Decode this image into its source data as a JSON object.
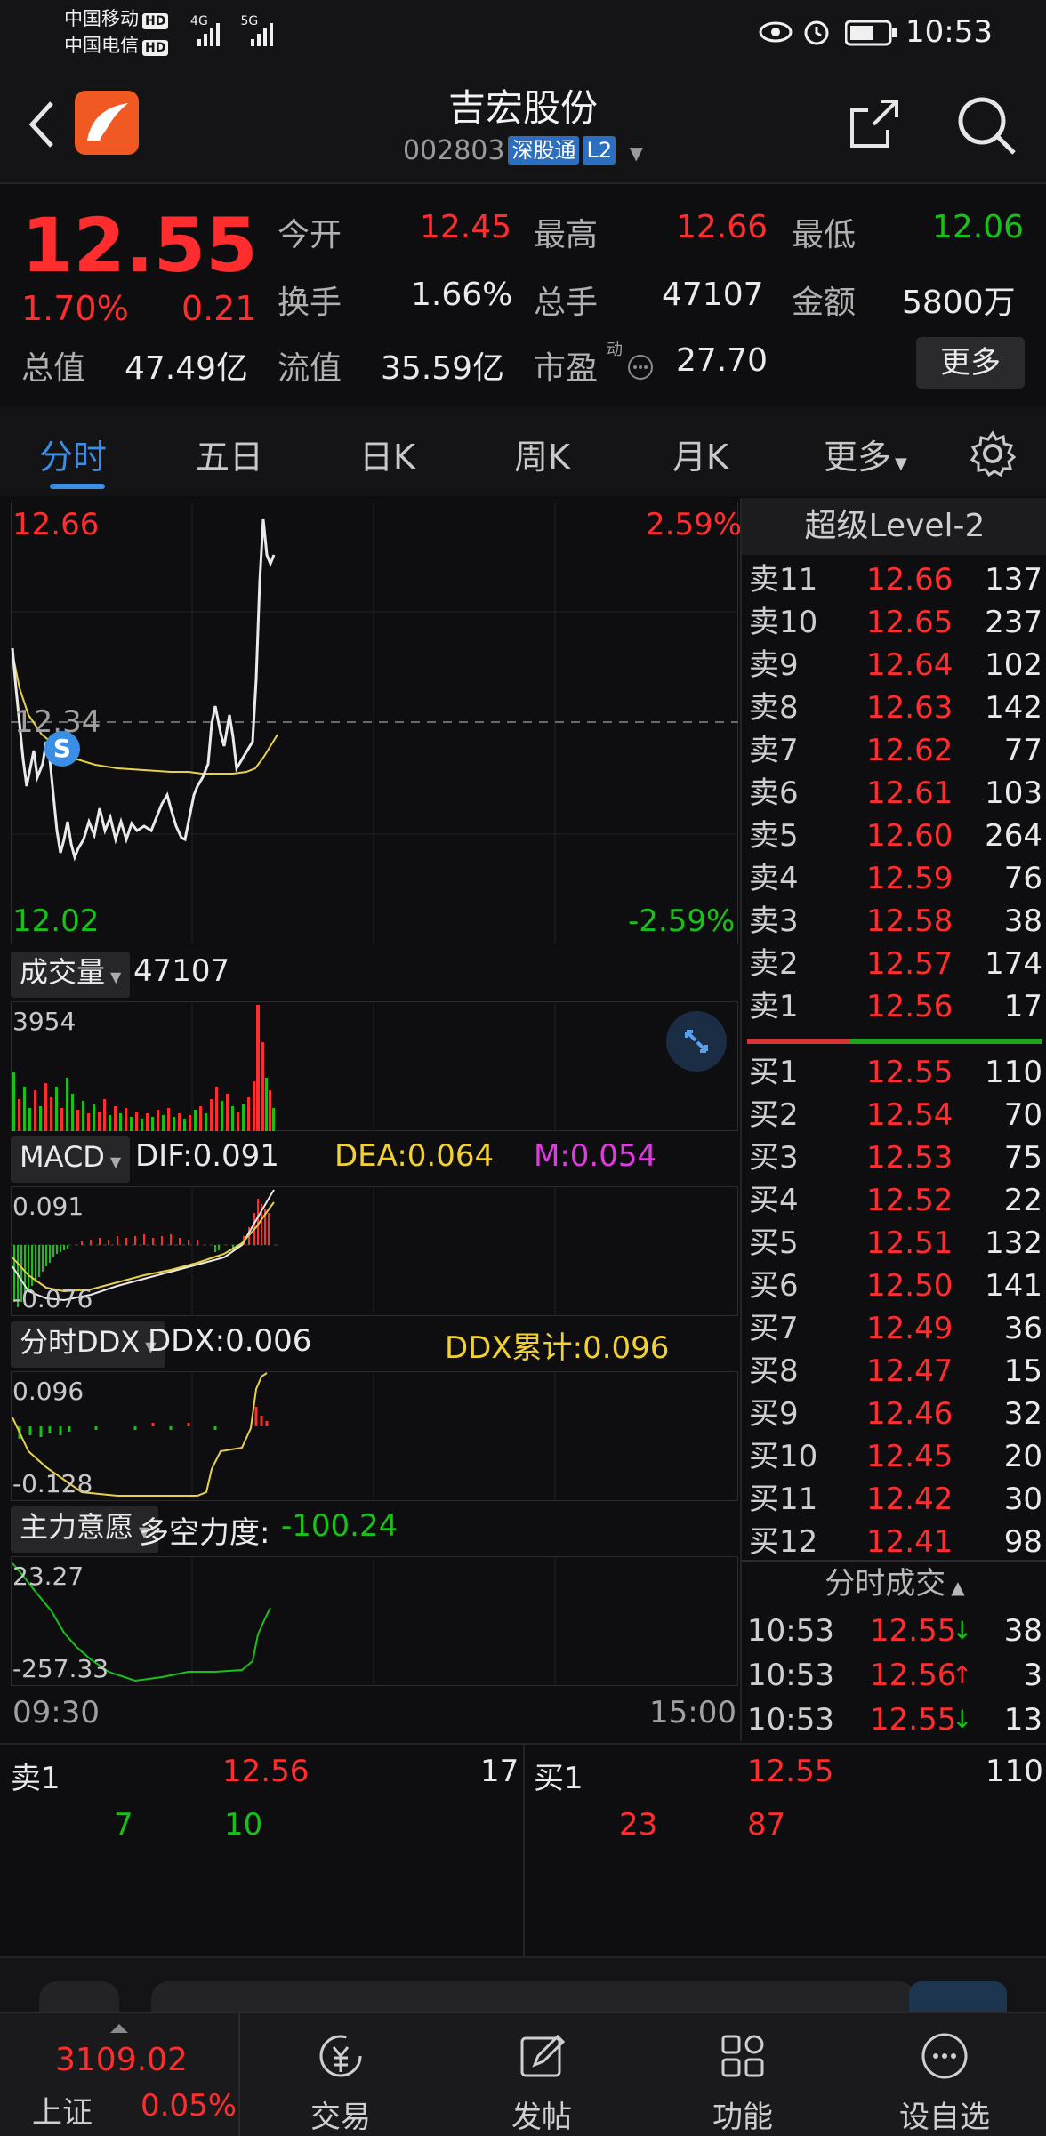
{
  "status_bar": {
    "carrier1": "中国移动",
    "carrier2": "中国电信",
    "hd": "HD",
    "net1": "4G",
    "net2": "5G",
    "time": "10:53"
  },
  "header": {
    "title": "吉宏股份",
    "code": "002803",
    "tag1": "深股通",
    "tag2": "L2"
  },
  "quote": {
    "price": "12.55",
    "change_pct": "1.70%",
    "change_amt": "0.21",
    "open_label": "今开",
    "open": "12.45",
    "high_label": "最高",
    "high": "12.66",
    "low_label": "最低",
    "low": "12.06",
    "turnover_label": "换手",
    "turnover": "1.66%",
    "volume_label": "总手",
    "volume": "47107",
    "amount_label": "金额",
    "amount": "5800万",
    "mktcap_label": "总值",
    "mktcap": "47.49亿",
    "float_label": "流值",
    "float": "35.59亿",
    "pe_label": "市盈",
    "pe_sup": "动",
    "pe": "27.70",
    "more_label": "更多"
  },
  "tabs": [
    "分时",
    "五日",
    "日K",
    "周K",
    "月K",
    "更多"
  ],
  "chart": {
    "price_top": "12.66",
    "price_mid": "12.34",
    "price_bottom": "12.02",
    "pct_top": "2.59%",
    "pct_bottom": "-2.59%",
    "s_marker": "S",
    "volume_selector": "成交量",
    "volume_value": "47107",
    "volume_max": "3954",
    "macd_selector": "MACD",
    "dif": "DIF:0.091",
    "dea": "DEA:0.064",
    "m": "M:0.054",
    "macd_top": "0.091",
    "macd_bottom": "-0.076",
    "ddx_selector": "分时DDX",
    "ddx": "DDX:0.006",
    "ddx_cum": "DDX累计:0.096",
    "ddx_top": "0.096",
    "ddx_bottom": "-0.128",
    "main_selector": "主力意愿",
    "force_label": "多空力度:",
    "force_value": "-100.24",
    "main_top": "23.27",
    "main_bottom": "-257.33",
    "time_start": "09:30",
    "time_end": "15:00"
  },
  "book": {
    "title": "超级Level-2",
    "asks": [
      {
        "n": "卖11",
        "p": "12.66",
        "q": "137"
      },
      {
        "n": "卖10",
        "p": "12.65",
        "q": "237"
      },
      {
        "n": "卖9",
        "p": "12.64",
        "q": "102"
      },
      {
        "n": "卖8",
        "p": "12.63",
        "q": "142"
      },
      {
        "n": "卖7",
        "p": "12.62",
        "q": "77"
      },
      {
        "n": "卖6",
        "p": "12.61",
        "q": "103"
      },
      {
        "n": "卖5",
        "p": "12.60",
        "q": "264"
      },
      {
        "n": "卖4",
        "p": "12.59",
        "q": "76"
      },
      {
        "n": "卖3",
        "p": "12.58",
        "q": "38"
      },
      {
        "n": "卖2",
        "p": "12.57",
        "q": "174"
      },
      {
        "n": "卖1",
        "p": "12.56",
        "q": "17"
      }
    ],
    "bids": [
      {
        "n": "买1",
        "p": "12.55",
        "q": "110"
      },
      {
        "n": "买2",
        "p": "12.54",
        "q": "70"
      },
      {
        "n": "买3",
        "p": "12.53",
        "q": "75"
      },
      {
        "n": "买4",
        "p": "12.52",
        "q": "22"
      },
      {
        "n": "买5",
        "p": "12.51",
        "q": "132"
      },
      {
        "n": "买6",
        "p": "12.50",
        "q": "141"
      },
      {
        "n": "买7",
        "p": "12.49",
        "q": "36"
      },
      {
        "n": "买8",
        "p": "12.47",
        "q": "15"
      },
      {
        "n": "买9",
        "p": "12.46",
        "q": "32"
      },
      {
        "n": "买10",
        "p": "12.45",
        "q": "20"
      },
      {
        "n": "买11",
        "p": "12.42",
        "q": "30"
      },
      {
        "n": "买12",
        "p": "12.41",
        "q": "98"
      }
    ],
    "trades_title": "分时成交",
    "trades": [
      {
        "t": "10:53",
        "p": "12.55",
        "dir": "↓",
        "q": "38"
      },
      {
        "t": "10:53",
        "p": "12.56",
        "dir": "↑",
        "q": "3"
      },
      {
        "t": "10:53",
        "p": "12.55",
        "dir": "↓",
        "q": "13"
      }
    ]
  },
  "bottom_quote": {
    "ask_label": "卖1",
    "ask_price": "12.56",
    "ask_qty": "17",
    "bid_label": "买1",
    "bid_price": "12.55",
    "bid_qty": "110",
    "ask_sub1": "7",
    "ask_sub2": "10",
    "bid_sub1": "23",
    "bid_sub2": "87"
  },
  "nav": {
    "index_value": "3109.02",
    "index_name": "上证",
    "index_pct": "0.05%",
    "items": [
      "交易",
      "发帖",
      "功能",
      "设自选"
    ]
  },
  "colors": {
    "up": "#ff2d2d",
    "down": "#18c118",
    "accent": "#3a8ee6",
    "avg_line": "#e8d14a"
  }
}
